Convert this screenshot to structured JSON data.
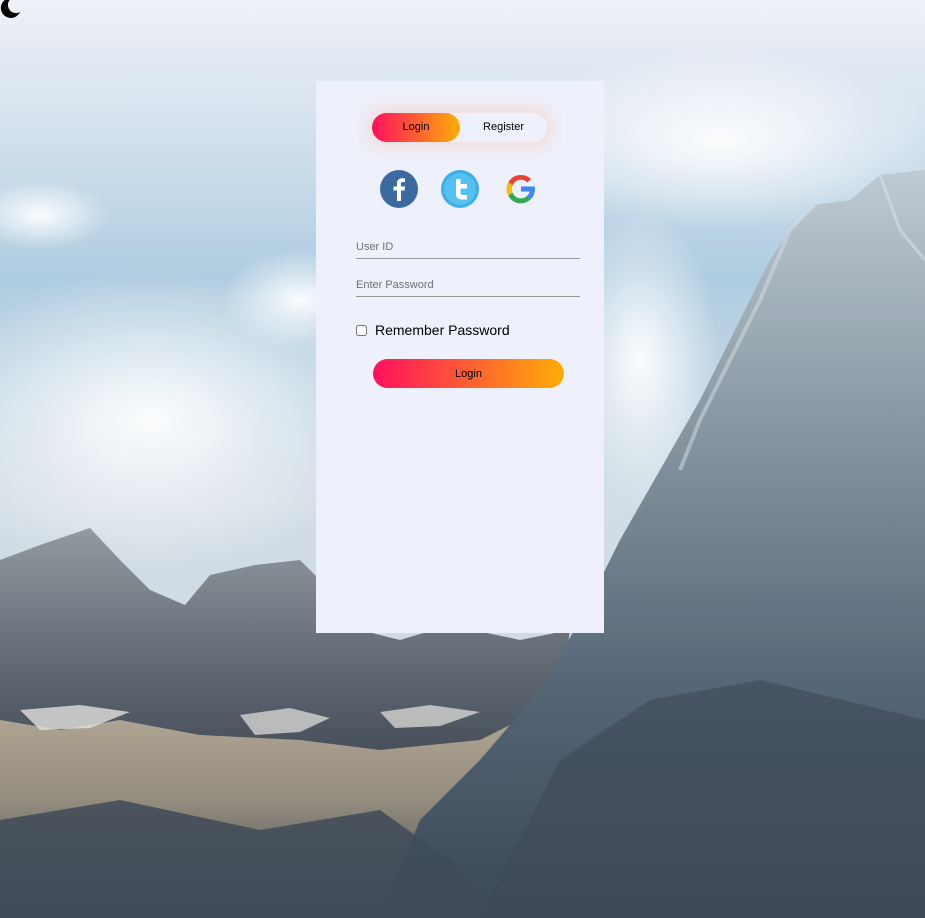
{
  "toggle": {
    "login_label": "Login",
    "register_label": "Register",
    "active": "Login"
  },
  "social": [
    {
      "icon": "facebook-icon",
      "color": "#3b5998"
    },
    {
      "icon": "twitter-icon",
      "color": "#55acee"
    },
    {
      "icon": "google-icon",
      "color": "#4285f4"
    }
  ],
  "form": {
    "user_id_placeholder": "User ID",
    "user_id_value": "",
    "password_placeholder": "Enter Password",
    "password_value": "",
    "remember_label": "Remember Password",
    "remember_checked": false,
    "submit_label": "Login"
  },
  "theme": {
    "gradient_start": "#ff105f",
    "gradient_end": "#ffad06",
    "card_background": "#eef1fc"
  },
  "top_left_icon": "moon-icon"
}
